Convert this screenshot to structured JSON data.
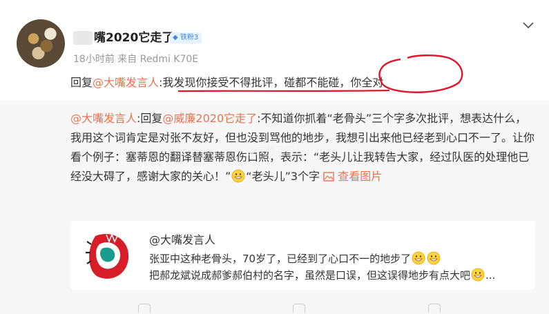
{
  "post": {
    "nickname": "嘴2020它走了",
    "badge": "铁粉3",
    "time": "18小时前",
    "source_prefix": "来自",
    "source": "Redmi K70E",
    "reply_prefix": "回复",
    "reply_mention": "@大嘴发言人",
    "reply_colon": ":",
    "reply_text": "我发现你接受不得批评，碰都不能碰，你全对"
  },
  "quoted": {
    "author": "@大嘴发言人",
    "reply_prefix": ":回复",
    "reply_mention": "@威廉2020它走了",
    "text": ":不知道你抓着“老骨头”三个字多次批评，想表达什么，我用这个词肯定是对张不友好，但也没到骂他的地步，我想引出来他已经老到心口不一了。让你看个例子：塞蒂恩的翻译替塞蒂恩伤口照，表示：“老头儿让我转告大家，经过队医的处理他已经没大碍了，感谢大家的关心！”",
    "text_tail": "“老头儿”3个字",
    "view_pic": "查看图片",
    "watermark": "@大嘴发言人"
  },
  "inner_card": {
    "name": "@大嘴发言人",
    "line1": "张亚中这种老骨头，70岁了，已经到了心口不一的地步了",
    "line2": "把郝龙斌说成郝爹郝伯村的名字，虽然是口误，但这误得地步有点大吧",
    "line2_tail": "..."
  },
  "icons": {
    "more": "chevron-down-icon",
    "emoji": "grin-emoji-icon",
    "picture": "picture-icon"
  },
  "colors": {
    "link": "#eb7350",
    "badge_text": "#3b8ae0",
    "annotation": "#e0152c"
  }
}
